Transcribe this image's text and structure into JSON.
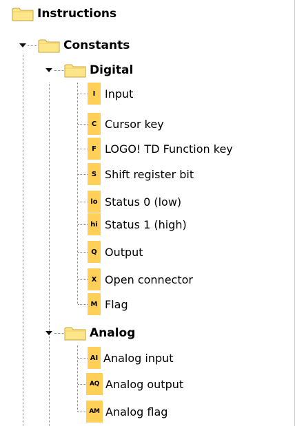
{
  "tree": {
    "root": {
      "label": "Instructions",
      "icon": "folder-icon"
    },
    "constants": {
      "label": "Constants",
      "icon": "folder-icon",
      "expanded": true
    },
    "digital": {
      "label": "Digital",
      "icon": "folder-icon",
      "expanded": true,
      "items": [
        {
          "code": "I",
          "label": "Input"
        },
        {
          "code": "C",
          "label": "Cursor key"
        },
        {
          "code": "F",
          "label": "LOGO! TD Function key"
        },
        {
          "code": "S",
          "label": "Shift register bit"
        },
        {
          "code": "lo",
          "label": "Status 0 (low)"
        },
        {
          "code": "hi",
          "label": "Status 1 (high)"
        },
        {
          "code": "Q",
          "label": "Output"
        },
        {
          "code": "X",
          "label": "Open connector"
        },
        {
          "code": "M",
          "label": "Flag"
        }
      ]
    },
    "analog": {
      "label": "Analog",
      "icon": "folder-icon",
      "expanded": true,
      "items": [
        {
          "code": "AI",
          "label": "Analog input"
        },
        {
          "code": "AQ",
          "label": "Analog output"
        },
        {
          "code": "AM",
          "label": "Analog flag"
        }
      ]
    }
  },
  "colors": {
    "item_icon_bg": "#ffcf57",
    "folder_fill": "#fde58a",
    "folder_stroke": "#c9a23a"
  }
}
